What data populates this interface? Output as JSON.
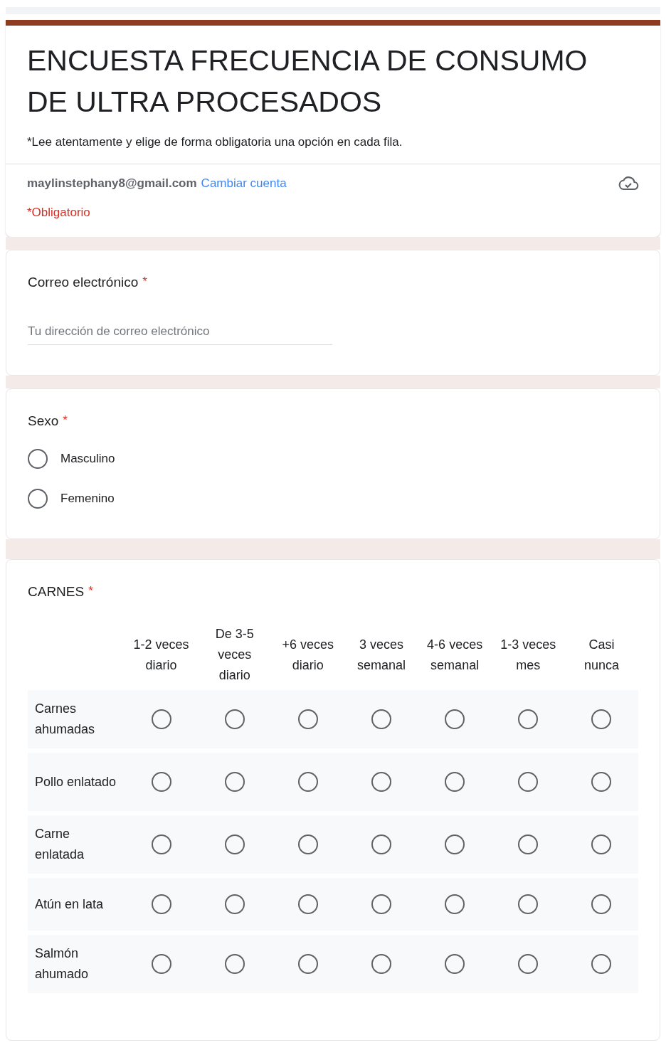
{
  "form": {
    "title": "ENCUESTA FRECUENCIA DE CONSUMO DE ULTRA PROCESADOS",
    "description": "*Lee atentamente y elige de forma obligatoria una opción en cada fila.",
    "account": "maylinstephany8@gmail.com",
    "switch_account": "Cambiar cuenta",
    "required_note": "*Obligatorio"
  },
  "questions": [
    {
      "kind": "text",
      "title": "Correo electrónico",
      "required_mark": "*",
      "placeholder": "Tu dirección de correo electrónico"
    },
    {
      "kind": "choice",
      "title": "Sexo",
      "required_mark": "*",
      "options": [
        {
          "label": "Masculino",
          "selected": false
        },
        {
          "label": "Femenino",
          "selected": false
        }
      ]
    },
    {
      "kind": "grid",
      "title": "CARNES",
      "required_mark": "*",
      "columns": [
        "1-2 veces diario",
        "De 3-5 veces diario",
        "+6 veces diario",
        "3 veces semanal",
        "4-6 veces semanal",
        "1-3 veces mes",
        "Casi nunca"
      ],
      "rows": [
        {
          "label": "Carnes ahumadas",
          "choices": [
            {
              "selected": false
            },
            {
              "selected": false
            },
            {
              "selected": false
            },
            {
              "selected": false
            },
            {
              "selected": false
            },
            {
              "selected": false
            },
            {
              "selected": false
            }
          ]
        },
        {
          "label": "Pollo enlatado",
          "choices": [
            {
              "selected": false
            },
            {
              "selected": false
            },
            {
              "selected": false
            },
            {
              "selected": false
            },
            {
              "selected": false
            },
            {
              "selected": false
            },
            {
              "selected": false
            }
          ]
        },
        {
          "label": "Carne enlatada",
          "choices": [
            {
              "selected": false
            },
            {
              "selected": false
            },
            {
              "selected": false
            },
            {
              "selected": false
            },
            {
              "selected": false
            },
            {
              "selected": false
            },
            {
              "selected": false
            }
          ]
        },
        {
          "label": "Atún en lata",
          "choices": [
            {
              "selected": false
            },
            {
              "selected": false
            },
            {
              "selected": false
            },
            {
              "selected": false
            },
            {
              "selected": false
            },
            {
              "selected": false
            },
            {
              "selected": false
            }
          ]
        },
        {
          "label": "Salmón ahumado",
          "choices": [
            {
              "selected": false
            },
            {
              "selected": false
            },
            {
              "selected": false
            },
            {
              "selected": false
            },
            {
              "selected": false
            },
            {
              "selected": false
            },
            {
              "selected": false
            }
          ]
        }
      ]
    }
  ]
}
